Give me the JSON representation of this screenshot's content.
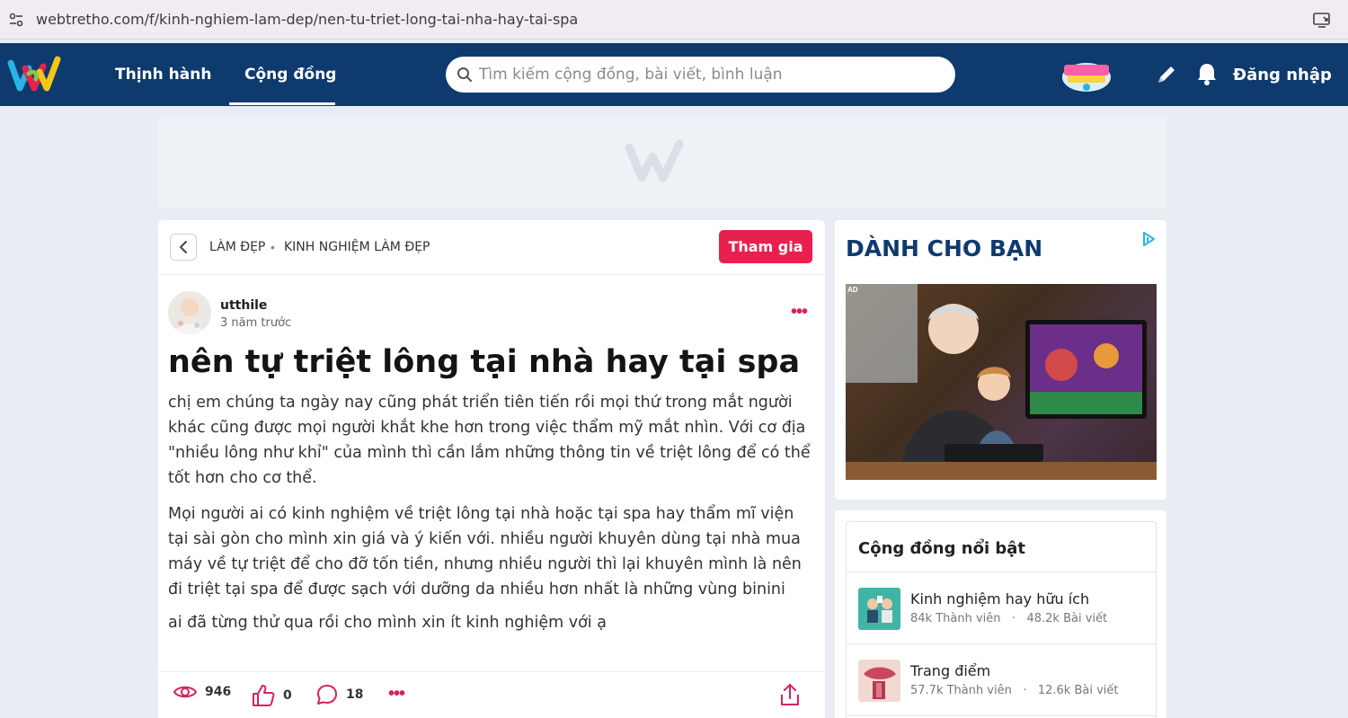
{
  "browser": {
    "url": "webtretho.com/f/kinh-nghiem-lam-dep/nen-tu-triet-long-tai-nha-hay-tai-spa"
  },
  "nav": {
    "trending": "Thịnh hành",
    "community": "Cộng đồng",
    "search_placeholder": "Tìm kiếm cộng đồng, bài viết, bình luận",
    "login": "Đăng nhập"
  },
  "breadcrumb": {
    "level1": "LÀM ĐẸP",
    "separator": "•",
    "level2": "KINH NGHIỆM LÀM ĐẸP",
    "join_label": "Tham gia"
  },
  "post": {
    "author": "utthile",
    "time": "3 năm trước",
    "title": "nên tự triệt lông tại nhà hay tại spa",
    "paragraphs": [
      "chị em chúng ta ngày nay cũng phát triển tiên tiến rồi mọi thứ trong mắt người khác cũng được mọi người khắt khe hơn trong việc thẩm mỹ mắt nhìn. Với cơ địa \"nhiều lông như khỉ\" của mình thì cần lắm những thông tin về triệt lông để có thể tốt hơn cho cơ thể.",
      "Mọi người ai có kinh nghiệm về triệt lông tại nhà hoặc tại spa hay thẩm mĩ viện tại sài gòn cho mình xin giá và ý kiến với. nhiều người khuyên dùng tại nhà mua máy về tự triệt để cho đỡ tốn tiền, nhưng nhiều người thì lại khuyên mình là nên đi triệt tại spa để được sạch với dưỡng da nhiều hơn nhất là những vùng binini",
      "ai đã từng thử qua rồi cho mình xin ít kinh nghiệm với ạ"
    ],
    "views": "946",
    "likes": "0",
    "comments": "18",
    "more": "•••"
  },
  "sidebar": {
    "ad_title": "DÀNH CHO BẠN",
    "ad_label": "AD",
    "community_heading": "Cộng đồng nổi bật",
    "communities": [
      {
        "name": "Kinh nghiệm hay hữu ích",
        "members": "84k Thành viên",
        "dot": "·",
        "posts": "48.2k Bài viết"
      },
      {
        "name": "Trang điểm",
        "members": "57.7k Thành viên",
        "dot": "·",
        "posts": "12.6k Bài viết"
      }
    ]
  },
  "colors": {
    "nav_bg": "#0e3a6e",
    "accent": "#e8204e",
    "icon_accent": "#d2255e"
  }
}
